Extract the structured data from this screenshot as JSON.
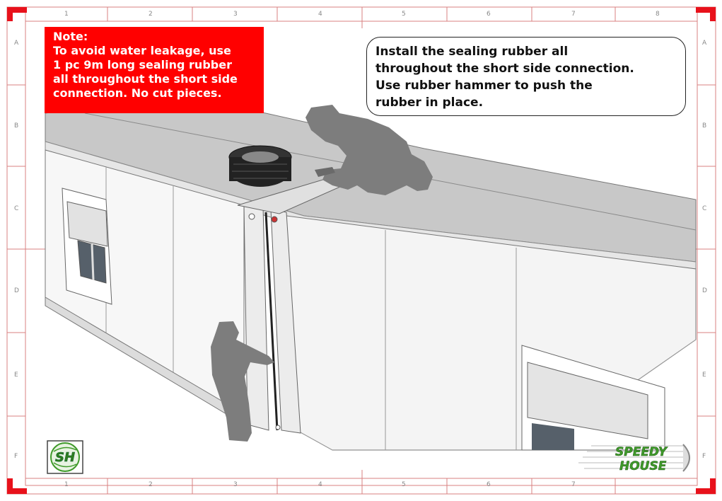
{
  "sheet": {
    "col_labels_top": [
      "1",
      "2",
      "3",
      "4",
      "5",
      "6",
      "7",
      "8"
    ],
    "col_labels_bottom": [
      "1",
      "2",
      "3",
      "4",
      "5",
      "6",
      "7"
    ],
    "row_labels": [
      "A",
      "B",
      "C",
      "D",
      "E",
      "F"
    ],
    "accent_color": "#e8111b"
  },
  "note": {
    "title": "Note:",
    "lines": [
      "To avoid water leakage, use",
      "1 pc 9m long sealing rubber",
      "all throughout the short side",
      "connection. No cut pieces."
    ]
  },
  "callout": {
    "lines": [
      "Install the sealing rubber all",
      "throughout the short side connection.",
      "Use rubber hammer to push the",
      "rubber in place."
    ]
  },
  "logos": {
    "sh_monogram": "SH",
    "brand_line1": "SPEEDY",
    "brand_line2": "HOUSE",
    "brand_color": "#3f9a2a"
  }
}
